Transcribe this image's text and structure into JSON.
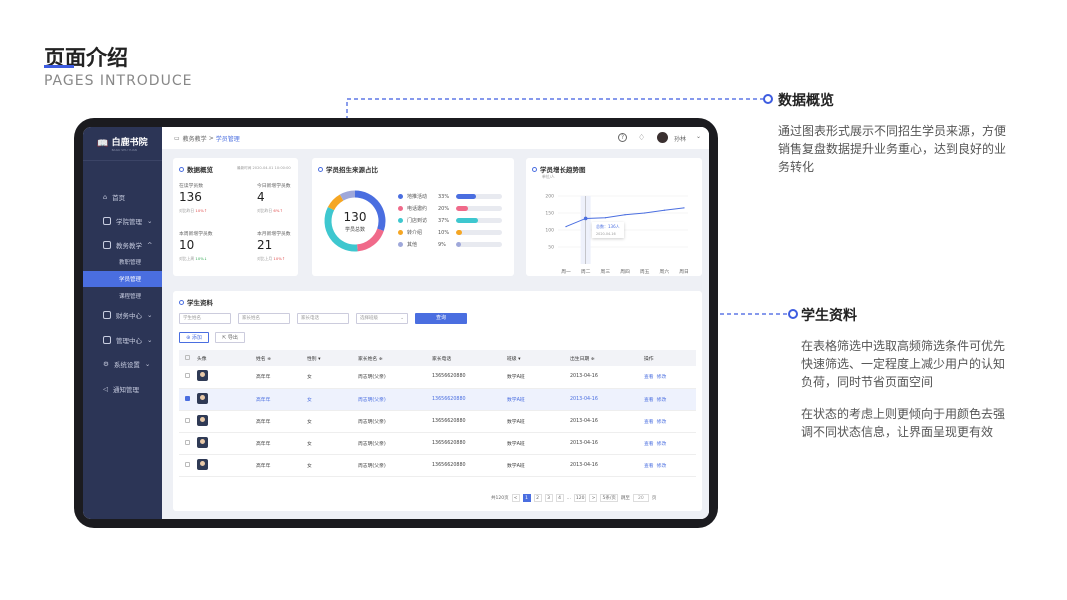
{
  "header": {
    "title": "页面介绍",
    "subtitle": "PAGES INTRODUCE"
  },
  "colors": {
    "accent": "#4a6ee0",
    "sidebar": "#2c3556",
    "up": "#e05050",
    "down": "#3aaa5a"
  },
  "app": {
    "logo": "白鹿书院",
    "logo_sub": "BAILU SHU YUAN",
    "breadcrumb": {
      "parent": "教务教学",
      "sep": ">",
      "current": "学员管理"
    },
    "user": "孙林",
    "sidebar": {
      "home": "首页",
      "school": "学院管理",
      "teaching": "教务教学",
      "sub1": "教职管理",
      "sub2": "学员管理",
      "sub3": "课程管理",
      "finance": "财务中心",
      "manage": "管理中心",
      "settings": "系统设置",
      "notice": "通知管理"
    }
  },
  "overview": {
    "title": "数据概览",
    "update": "最新时间 2020-04-01 10:00:00",
    "stats": [
      {
        "label": "在读学员数",
        "value": "136",
        "cmp": "对比昨日",
        "pct": "10%",
        "dir": "↑"
      },
      {
        "label": "今日新增学员数",
        "value": "4",
        "cmp": "对比昨日",
        "pct": "6%",
        "dir": "↑"
      },
      {
        "label": "本周新增学员数",
        "value": "10",
        "cmp": "对比上周",
        "pct": "10%",
        "dir": "↓"
      },
      {
        "label": "本月新增学员数",
        "value": "21",
        "cmp": "对比上月",
        "pct": "10%",
        "dir": "↑"
      }
    ]
  },
  "source": {
    "title": "学员招生来源占比",
    "total": "130",
    "total_label": "学员总数",
    "items": [
      {
        "name": "地推活动",
        "pct": "33%",
        "value": 33,
        "color": "#4a6ee0"
      },
      {
        "name": "电话邀约",
        "pct": "20%",
        "value": 20,
        "color": "#f06a8a"
      },
      {
        "name": "门店到访",
        "pct": "37%",
        "value": 37,
        "color": "#3ec7cf"
      },
      {
        "name": "转介绍",
        "pct": "10%",
        "value": 10,
        "color": "#f5a623"
      },
      {
        "name": "其他",
        "pct": "9%",
        "value": 9,
        "color": "#9fa8da"
      }
    ]
  },
  "trend": {
    "title": "学员增长趋势图",
    "unit": "单位/人",
    "tooltip_label": "总数：136人",
    "tooltip_date": "2020-04-16"
  },
  "chart_data": [
    {
      "type": "pie",
      "title": "学员招生来源占比",
      "categories": [
        "地推活动",
        "电话邀约",
        "门店到访",
        "转介绍",
        "其他"
      ],
      "values": [
        33,
        20,
        37,
        10,
        9
      ]
    },
    {
      "type": "line",
      "title": "学员增长趋势图",
      "ylabel": "单位/人",
      "categories": [
        "周一",
        "周二",
        "周三",
        "周四",
        "周五",
        "周六",
        "周日"
      ],
      "values": [
        110,
        134,
        136,
        145,
        150,
        158,
        165
      ],
      "ylim": [
        0,
        200
      ],
      "yticks": [
        "200",
        "150",
        "100",
        "50"
      ]
    }
  ],
  "students": {
    "title": "学生资料",
    "filters": {
      "name": "学生姓名",
      "parent": "家长姓名",
      "phone": "家长电话",
      "class": "选择班级",
      "search": "查询"
    },
    "add": "添加",
    "export": "导出",
    "columns": [
      "头像",
      "姓名 ≑",
      "性别 ▾",
      "家长姓名 ≑",
      "家长电话",
      "班级 ▾",
      "出生日期 ≑",
      "操作"
    ],
    "view": "查看",
    "edit": "修改",
    "rows": [
      {
        "name": "高年年",
        "gender": "女",
        "parent": "周志明(父亲)",
        "phone": "13656620880",
        "class": "数学A班",
        "birth": "2013-04-16",
        "selected": false
      },
      {
        "name": "高年年",
        "gender": "女",
        "parent": "周志明(父亲)",
        "phone": "13656620880",
        "class": "数学A班",
        "birth": "2013-04-16",
        "selected": true
      },
      {
        "name": "高年年",
        "gender": "女",
        "parent": "周志明(父亲)",
        "phone": "13656620880",
        "class": "数学A班",
        "birth": "2013-04-16",
        "selected": false
      },
      {
        "name": "高年年",
        "gender": "女",
        "parent": "周志明(父亲)",
        "phone": "13656620880",
        "class": "数学A班",
        "birth": "2013-04-16",
        "selected": false
      },
      {
        "name": "高年年",
        "gender": "女",
        "parent": "周志明(父亲)",
        "phone": "13656620880",
        "class": "数学A班",
        "birth": "2013-04-16",
        "selected": false
      }
    ],
    "pagination": {
      "total": "共120页",
      "prev": "<",
      "pages": [
        "1",
        "2",
        "3",
        "4",
        "...",
        "120"
      ],
      "next": ">",
      "size": "5条/页",
      "jump": "跳至",
      "jump_val": "20",
      "page_unit": "页"
    }
  },
  "annotations": {
    "overview_title": "数据概览",
    "overview_text": "通过图表形式展示不同招生学员来源，方便销售复盘数据提升业务重心，达到良好的业务转化",
    "students_title": "学生资料",
    "students_text1": "在表格筛选中选取高频筛选条件可优先快速筛选、一定程度上减少用户的认知负荷，同时节省页面空间",
    "students_text2": "在状态的考虑上则更倾向于用颜色去强调不同状态信息，让界面呈现更有效"
  }
}
